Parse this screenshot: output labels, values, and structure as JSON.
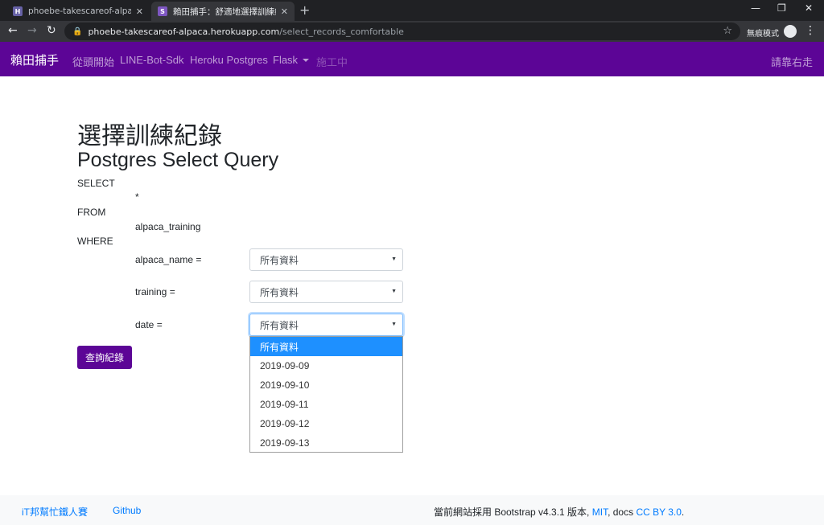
{
  "browser": {
    "tabs": [
      {
        "title": "phoebe-takescareof-alpaca · Log",
        "favicon": "heroku-icon",
        "active": false
      },
      {
        "title": "賴田捕手：舒適地選擇訓練紀錄",
        "favicon": "site-icon",
        "active": true
      }
    ],
    "url_host": "phoebe-takescareof-alpaca.herokuapp.com",
    "url_path": "/select_records_comfortable",
    "incognito_label": "無痕模式"
  },
  "navbar": {
    "brand": "賴田捕手",
    "items": [
      {
        "label": "從頭開始",
        "disabled": false
      },
      {
        "label": "LINE-Bot-Sdk",
        "disabled": false
      },
      {
        "label": "Heroku Postgres",
        "disabled": false
      },
      {
        "label": "Flask",
        "disabled": false,
        "dropdown": true
      },
      {
        "label": "施工中",
        "disabled": true
      }
    ],
    "right": "請靠右走"
  },
  "page": {
    "title": "選擇訓練紀錄",
    "subtitle": "Postgres Select Query",
    "sql": {
      "select": "SELECT",
      "star": "*",
      "from": "FROM",
      "table": "alpaca_training",
      "where": "WHERE"
    },
    "filters": [
      {
        "label": "alpaca_name =",
        "value": "所有資料"
      },
      {
        "label": "training =",
        "value": "所有資料"
      },
      {
        "label": "date =",
        "value": "所有資料"
      }
    ],
    "date_options": [
      "所有資料",
      "2019-09-09",
      "2019-09-10",
      "2019-09-11",
      "2019-09-12",
      "2019-09-13"
    ],
    "selected_option_index": 0,
    "submit_label": "查詢紀錄"
  },
  "footer": {
    "links": [
      "iT邦幫忙鐵人賽",
      "Github"
    ],
    "text_prefix": "當前網站採用 Bootstrap v4.3.1 版本,",
    "mit": "MIT",
    "docs": ", docs",
    "cc": "CC BY 3.0",
    "end": "."
  },
  "colors": {
    "navbar": "#5c0596",
    "button": "#5c0596",
    "link": "#007bff",
    "option_highlight": "#1e90ff"
  }
}
